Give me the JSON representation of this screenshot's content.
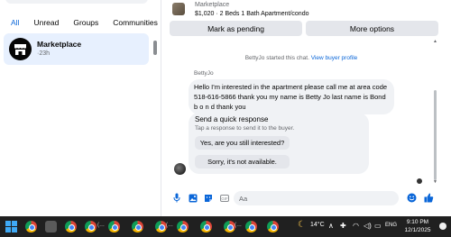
{
  "sidebar": {
    "filters": [
      "All",
      "Unread",
      "Groups",
      "Communities"
    ],
    "active_filter": "All",
    "chats": [
      {
        "name": "Marketplace",
        "time": "·23h"
      }
    ]
  },
  "listing": {
    "name": "Marketplace",
    "title": "$1,020 · 2 Beds 1 Bath Apartment/condo",
    "actions": [
      "Mark as pending",
      "More options"
    ]
  },
  "conversation": {
    "system_message": "BettyJo started this chat.",
    "system_link": "View buyer profile",
    "sender": "BettyJo",
    "message": "Hello I'm interested in the apartment please call me at area code 518-616-5866 thank you my name is Betty Jo last name is Bond b o n d thank you",
    "quick_response": {
      "title": "Send a quick response",
      "subtitle": "Tap a response to send it to the buyer.",
      "options": [
        "Yes, are you still interested?",
        "Sorry, it's not available."
      ]
    }
  },
  "composer": {
    "placeholder": "Aa"
  },
  "taskbar": {
    "temperature": "14°C",
    "language": "ENG",
    "time": "9:10 PM",
    "date": "12/1/2025"
  },
  "colors": {
    "accent": "#0a66d8",
    "selected_bg": "#e7f0fe",
    "bubble_bg": "#f0f2f5"
  }
}
